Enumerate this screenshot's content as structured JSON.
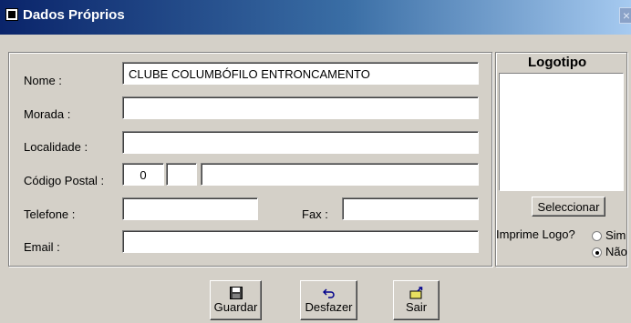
{
  "window": {
    "title": "Dados Próprios",
    "close": "×"
  },
  "form": {
    "nome_label": "Nome :",
    "nome_value": "CLUBE COLUMBÓFILO ENTRONCAMENTO",
    "morada_label": "Morada :",
    "morada_value": "",
    "localidade_label": "Localidade :",
    "localidade_value": "",
    "codigo_postal_label": "Código Postal :",
    "codigo_postal_1": "0",
    "codigo_postal_2": "",
    "codigo_postal_3": "",
    "telefone_label": "Telefone :",
    "telefone_value": "",
    "fax_label": "Fax :",
    "fax_value": "",
    "email_label": "Email :",
    "email_value": ""
  },
  "logo": {
    "title": "Logotipo",
    "select_button": "Seleccionar",
    "print_label": "Imprime Logo?",
    "option_yes": "Sim",
    "option_no": "Não",
    "selected": "Não"
  },
  "toolbar": {
    "save_label": "Guardar",
    "undo_label": "Desfazer",
    "exit_label": "Sair"
  },
  "icons": {
    "save": "floppy-disk-icon",
    "undo": "undo-arrow-icon",
    "exit": "exit-door-icon"
  }
}
